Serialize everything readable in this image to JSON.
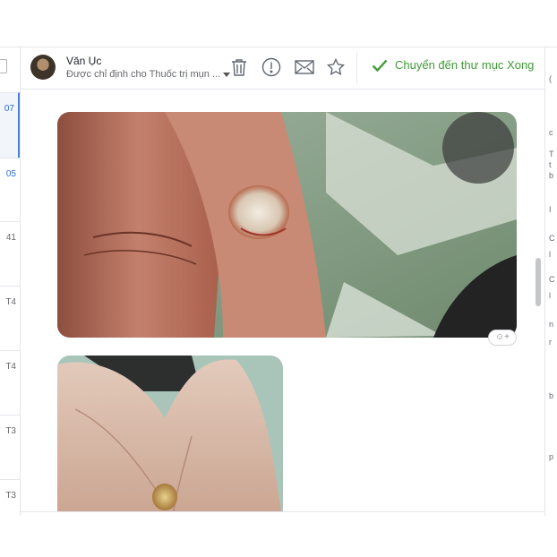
{
  "conversation": {
    "sender_name": "Văn Ục",
    "assignment_text": "Được chỉ định cho Thuốc trị mụn ..."
  },
  "toolbar": {
    "delete_icon": "trash-icon",
    "spam_icon": "exclamation-circle-icon",
    "mail_icon": "envelope-icon",
    "star_icon": "star-icon",
    "move_done_label": "Chuyển đến thư mục Xong"
  },
  "thread_list": {
    "times": [
      "07",
      "05",
      "41",
      "T4",
      "T4",
      "T3",
      "T3"
    ]
  },
  "right_panel": {
    "fragments": [
      "(",
      "c",
      "T",
      "t",
      "b",
      "I",
      "C",
      "l",
      "C",
      "l",
      "n",
      "r",
      "b",
      "p"
    ]
  },
  "colors": {
    "accent_green": "#3f9c35",
    "selected_blue": "#4d7ed8",
    "border": "#e4e6eb"
  }
}
